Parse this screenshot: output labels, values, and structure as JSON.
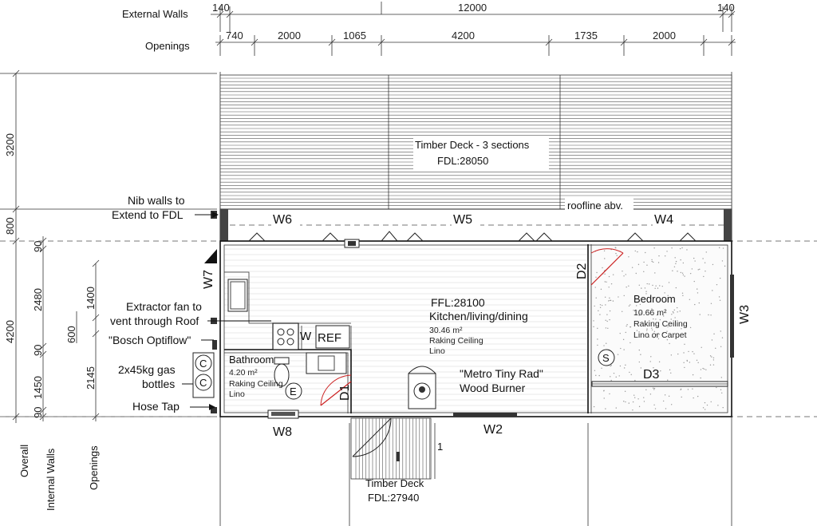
{
  "dimension_rows": {
    "external_walls": {
      "label": "External Walls",
      "values": [
        "140",
        "12000",
        "140"
      ]
    },
    "openings": {
      "label": "Openings",
      "values": [
        "740",
        "2000",
        "1065",
        "4200",
        "1735",
        "2000"
      ]
    }
  },
  "vertical_dimensions": {
    "overall": {
      "label": "Overall",
      "values": [
        "3200",
        "800",
        "4200"
      ]
    },
    "internal_walls": {
      "label": "Internal Walls",
      "values": [
        "90",
        "2480",
        "90",
        "1450",
        "90"
      ]
    },
    "openings": {
      "label": "Openings",
      "values": [
        "1400",
        "600",
        "2145"
      ]
    }
  },
  "annotations": {
    "nib_walls": [
      "Nib walls to",
      "Extend to FDL"
    ],
    "extractor": [
      "Extractor fan to",
      "vent through Roof"
    ],
    "bosch": "\"Bosch Optiflow\"",
    "gas": [
      "2x45kg gas",
      "bottles"
    ],
    "hose_tap": "Hose Tap",
    "roofline": "roofline abv."
  },
  "decks": {
    "top": {
      "title": "Timber Deck - 3 sections",
      "level": "FDL:28050"
    },
    "bottom": {
      "title": "Timber Deck",
      "level": "FDL:27940"
    }
  },
  "rooms": {
    "kitchen": {
      "ffl": "FFL:28100",
      "name": "Kitchen/living/dining",
      "area": "30.46 m²",
      "ceiling": "Raking Ceiling",
      "floor": "Lino"
    },
    "bedroom": {
      "name": "Bedroom",
      "area": "10.66 m²",
      "ceiling": "Raking Ceiling",
      "floor": "Lino or Carpet"
    },
    "bathroom": {
      "name": "Bathroom",
      "area": "4.20 m²",
      "ceiling": "Raking Ceiling",
      "floor": "Lino"
    }
  },
  "fixtures": {
    "burner": [
      "\"Metro Tiny Rad\"",
      "Wood Burner"
    ],
    "washer": "W",
    "fridge": "REF",
    "extractor_symbol": "E",
    "smoke": "S",
    "gas_symbol": "C",
    "step": "1"
  },
  "openings_marks": {
    "windows": [
      "W6",
      "W5",
      "W4",
      "W7",
      "W3",
      "W8",
      "W2"
    ],
    "doors": [
      "D2",
      "D1",
      "D3"
    ]
  }
}
